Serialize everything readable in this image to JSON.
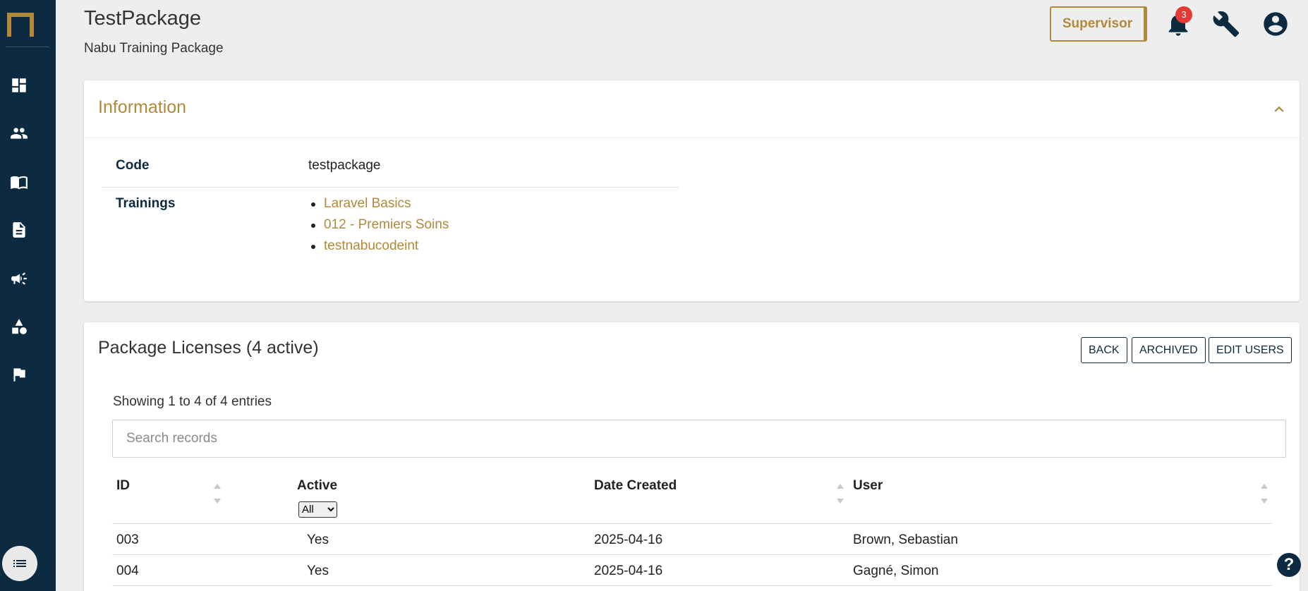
{
  "header": {
    "title": "TestPackage",
    "subtitle": "Nabu Training Package",
    "role_label": "Supervisor",
    "notification_count": "3"
  },
  "sidebar": {
    "items": [
      {
        "name": "dashboard-icon"
      },
      {
        "name": "users-icon"
      },
      {
        "name": "book-icon"
      },
      {
        "name": "document-icon"
      },
      {
        "name": "megaphone-icon"
      },
      {
        "name": "shapes-icon"
      },
      {
        "name": "flag-icon"
      }
    ],
    "toggle_icon": "list-icon"
  },
  "information": {
    "title": "Information",
    "code_label": "Code",
    "code_value": "testpackage",
    "trainings_label": "Trainings",
    "trainings": [
      "Laravel Basics",
      "012 - Premiers Soins",
      "testnabucodeint"
    ]
  },
  "licenses": {
    "title": "Package Licenses (4 active)",
    "buttons": {
      "back": "BACK",
      "archived": "ARCHIVED",
      "edit_users": "EDIT USERS"
    },
    "showing": "Showing 1 to 4 of 4 entries",
    "search_placeholder": "Search records",
    "columns": {
      "id": "ID",
      "active": "Active",
      "date_created": "Date Created",
      "user": "User"
    },
    "active_filter": {
      "selected": "All"
    },
    "rows": [
      {
        "id": "003",
        "active": "Yes",
        "date": "2025-04-16",
        "user": "Brown, Sebastian"
      },
      {
        "id": "004",
        "active": "Yes",
        "date": "2025-04-16",
        "user": "Gagné, Simon"
      }
    ]
  },
  "help": {
    "label": "?"
  },
  "colors": {
    "sidebar": "#0c2a40",
    "accent": "#b08a3a",
    "badge": "#e53935",
    "background": "#eeeeee"
  }
}
